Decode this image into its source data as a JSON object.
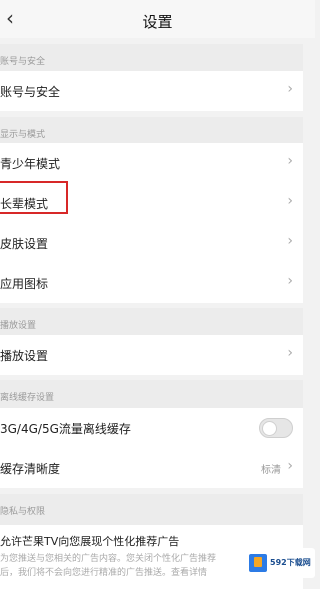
{
  "nav": {
    "back_glyph": "‹",
    "title": "设置"
  },
  "sections": {
    "account": "账号与安全",
    "display": "显示与模式",
    "playback": "播放设置",
    "cache": "离线缓存设置",
    "privacy": "隐私与权限"
  },
  "rows": {
    "account_security": "账号与安全",
    "youth_mode": "青少年模式",
    "elder_mode": "长辈模式",
    "skin": "皮肤设置",
    "app_icon": "应用图标",
    "playback": "播放设置",
    "cellular_cache": "3G/4G/5G流量离线缓存",
    "cache_quality": "缓存清晰度",
    "cache_quality_value": "标清"
  },
  "toggles": {
    "cellular_cache_on": false
  },
  "ad": {
    "title": "允许芒果TV向您展现个性化推荐广告",
    "desc_line1": "为您推送与您相关的广告内容。您关闭个性化广告推荐",
    "desc_line2": "后，我们将不会向您进行精准的广告推送。查看详情"
  },
  "watermark": {
    "text": "592下载网"
  },
  "icons": {
    "chevron": "›"
  },
  "colors": {
    "highlight": "#d72828",
    "accent": "#2c7be5"
  }
}
